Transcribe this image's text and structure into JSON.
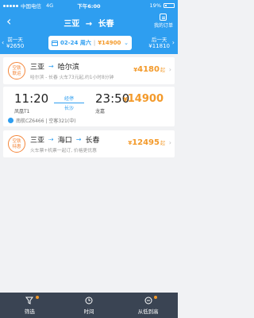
{
  "statusbar": {
    "carrier": "中国电信",
    "network": "4G",
    "time": "下午6:00",
    "battery": "19%"
  },
  "header": {
    "from": "三亚",
    "arrow": "→",
    "to": "长春",
    "my_orders": "我的订单"
  },
  "datebar": {
    "prev_label": "前一天",
    "prev_price": "¥2650",
    "current_date": "02-24 周六",
    "current_price": "¥14900",
    "next_label": "后一天",
    "next_price": "¥11810"
  },
  "cards": [
    {
      "tag": [
        "空铁",
        "联运"
      ],
      "from": "三亚",
      "arrow": "→",
      "to": "哈尔滨",
      "subtitle": "哈尔滨 - 长春 火车73元起,约1小时8分钟",
      "price_currency": "¥",
      "price": "4180",
      "price_suffix": "起"
    },
    {
      "tag": [
        "空铁",
        "特惠"
      ],
      "from": "三亚",
      "via": "海口",
      "to": "长春",
      "subtitle": "火车票+机票一起订, 价格更优惠",
      "price_currency": "¥",
      "price": "12495",
      "price_suffix": "起"
    }
  ],
  "flight": {
    "dep_time": "11:20",
    "arr_time": "23:50",
    "dep_airport": "凤凰T1",
    "arr_airport": "龙嘉",
    "stop_label": "经停",
    "stop_city": "长沙",
    "price_currency": "¥",
    "price": "14900",
    "airline": "南航CZ6466 | 空客321(中)"
  },
  "tabbar": {
    "filter": "筛选",
    "time": "时间",
    "sort": "从低到高"
  }
}
